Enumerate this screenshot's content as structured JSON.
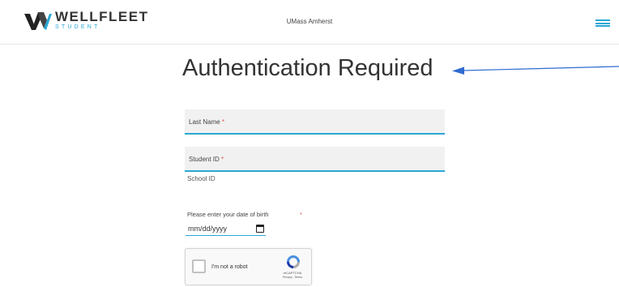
{
  "header": {
    "brand_name": "WELLFLEET",
    "brand_sub": "STUDENT",
    "school_name": "UMass Amherst",
    "menu_icon": "hamburger-icon"
  },
  "page": {
    "title": "Authentication Required"
  },
  "form": {
    "last_name_label": "Last Name",
    "student_id_label": "Student ID",
    "required_marker": "*",
    "student_id_help": "School ID",
    "dob_label": "Please enter your date of birth",
    "dob_placeholder": "mm/dd/yyyy",
    "dob_icon": "calendar-icon"
  },
  "recaptcha": {
    "label": "I'm not a robot",
    "brand": "reCAPTCHA",
    "links": "Privacy - Terms"
  },
  "colors": {
    "accent": "#2aa7d4",
    "arrow": "#2f6bd1",
    "required": "#e05050"
  }
}
